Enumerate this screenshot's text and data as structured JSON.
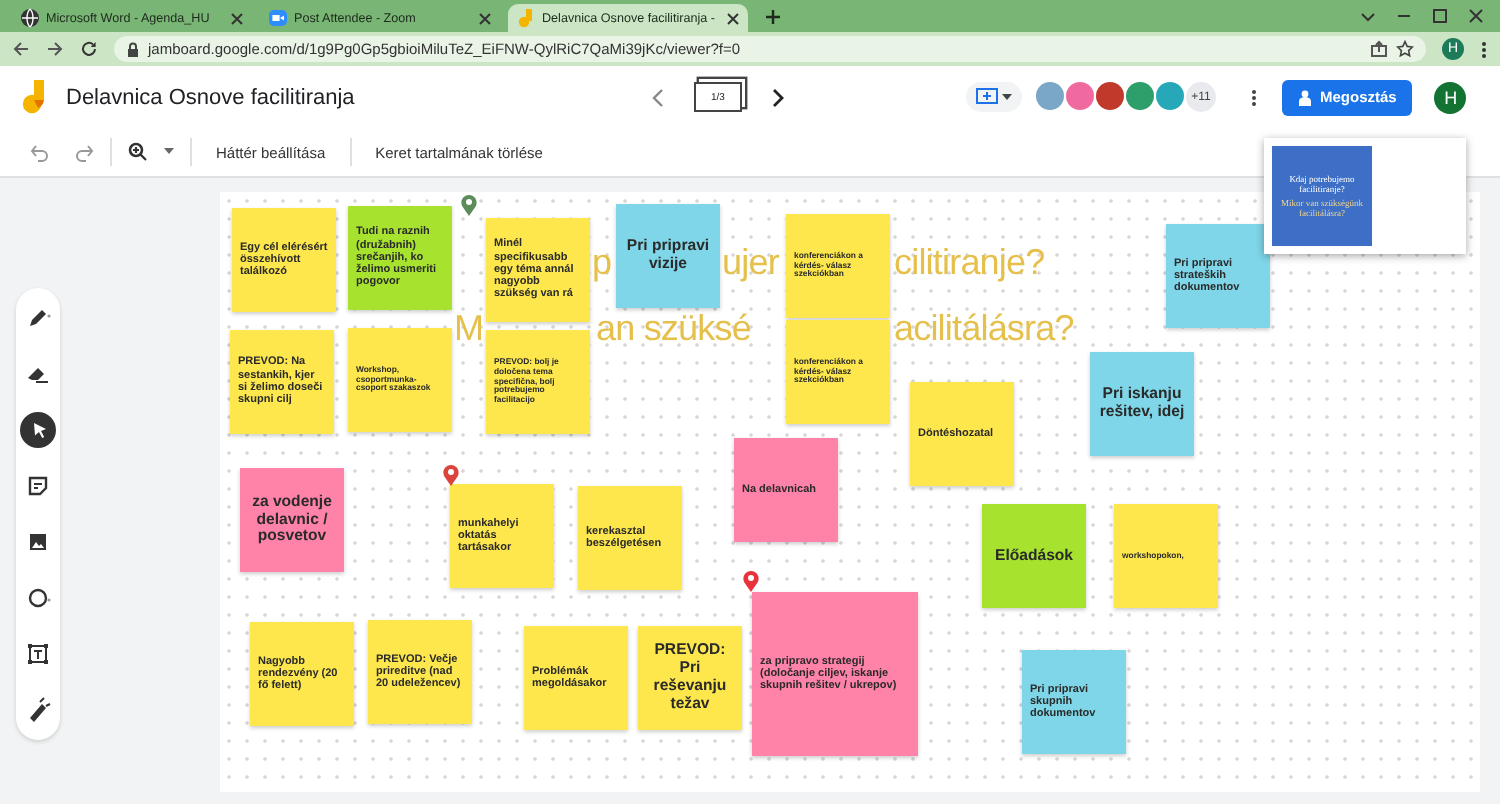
{
  "browser": {
    "tabs": [
      {
        "title": "Microsoft Word - Agenda_HU",
        "kind": "word",
        "selected": false
      },
      {
        "title": "Post Attendee - Zoom",
        "kind": "zoom",
        "selected": false
      },
      {
        "title": "Delavnica Osnove facilitiranja -",
        "kind": "jamboard",
        "selected": true
      }
    ],
    "url": "jamboard.google.com/d/1g9Pg0Gp5gbioiMiluTeZ_EiFNW-QylRiC7QaMi39jKc/viewer?f=0",
    "profile": "H"
  },
  "app": {
    "title": "Delavnica Osnove facilitiranja",
    "frame_counter": "1/3",
    "collaborators": [
      {
        "color": "#7aa7c7"
      },
      {
        "color": "#f06aa0"
      },
      {
        "color": "#c0392b"
      },
      {
        "color": "#2e9e6a"
      },
      {
        "color": "#26a8b8"
      }
    ],
    "collaborators_more": "+11",
    "share_button": "Megosztás",
    "avatar": "H"
  },
  "toolbar": {
    "buttons": [
      "Háttér beállítása",
      "Keret tartalmának törlése"
    ]
  },
  "tools": [
    {
      "kind": "pen",
      "selected": false
    },
    {
      "kind": "eraser",
      "selected": false
    },
    {
      "kind": "select",
      "selected": true
    },
    {
      "kind": "note",
      "selected": false
    },
    {
      "kind": "image",
      "selected": false
    },
    {
      "kind": "circle",
      "selected": false
    },
    {
      "kind": "textbox",
      "selected": false
    },
    {
      "kind": "laser",
      "selected": false
    }
  ],
  "board": {
    "heading_fragments": [
      "p",
      "ujer",
      "cilitiranje?",
      "M",
      "an szüksé",
      "acilitálásra?"
    ],
    "notes": [
      {
        "text": "Egy cél elérésért összehívott találkozó",
        "kind": "normal",
        "color": "#fde74c"
      },
      {
        "text": "Tudi na raznih (družabnih) srečanjih, ko želimo usmeriti pogovor",
        "kind": "normal",
        "color": "#a6e22e"
      },
      {
        "text": "Minél specifikusabb egy téma annál nagyobb szükség van rá",
        "kind": "normal",
        "color": "#fde74c"
      },
      {
        "text": "Pri pripravi vizije",
        "kind": "big",
        "color": "#7fd6e8"
      },
      {
        "text": "konferenciákon a kérdés- válasz szekciókban",
        "kind": "tiny",
        "color": "#fde74c"
      },
      {
        "text": "Pri pripravi strateških dokumentov",
        "kind": "normal",
        "color": "#7fd6e8"
      },
      {
        "text": "PREVOD: Na sestankih, kjer si želimo doseči skupni cilj",
        "kind": "normal",
        "color": "#fde74c"
      },
      {
        "text": "Workshop, csoportmunka-csoport szakaszok",
        "kind": "tiny",
        "color": "#fde74c"
      },
      {
        "text": "PREVOD: bolj je določena tema specifična, bolj potrebujemo facilitacijo",
        "kind": "tiny",
        "color": "#fde74c"
      },
      {
        "text": "konferenciákon a kérdés- válasz szekciókban",
        "kind": "tiny",
        "color": "#fde74c"
      },
      {
        "text": "Döntéshozatal",
        "kind": "normal",
        "color": "#fde74c"
      },
      {
        "text": "Pri iskanju rešitev, idej",
        "kind": "big",
        "color": "#7fd6e8"
      },
      {
        "text": "za vodenje delavnic / posvetov",
        "kind": "big",
        "color": "#ff82a9"
      },
      {
        "text": "munkahelyi oktatás tartásakor",
        "kind": "normal",
        "color": "#fde74c"
      },
      {
        "text": "kerekasztal beszélgetésen",
        "kind": "normal",
        "color": "#fde74c"
      },
      {
        "text": "Na delavnicah",
        "kind": "normal",
        "color": "#ff82a9"
      },
      {
        "text": "Előadások",
        "kind": "big",
        "color": "#a6e22e"
      },
      {
        "text": "workshopokon,",
        "kind": "tiny",
        "color": "#fde74c"
      },
      {
        "text": "Nagyobb rendezvény (20 fő felett)",
        "kind": "normal",
        "color": "#fde74c"
      },
      {
        "text": "PREVOD: Večje prireditve (nad 20 udeležencev)",
        "kind": "normal",
        "color": "#fde74c"
      },
      {
        "text": "Problémák megoldásakor",
        "kind": "normal",
        "color": "#fde74c"
      },
      {
        "text": "PREVOD: Pri reševanju težav",
        "kind": "big",
        "color": "#fde74c"
      },
      {
        "text": "za pripravo strategij (določanje ciljev, iskanje skupnih rešitev / ukrepov)",
        "kind": "normal",
        "color": "#ff82a9"
      },
      {
        "text": "Pri pripravi skupnih dokumentov",
        "kind": "normal",
        "color": "#7fd6e8"
      }
    ],
    "pins": [
      {
        "color": "#5b8c5a"
      },
      {
        "color": "#d9453c"
      },
      {
        "color": "#e8333c"
      }
    ]
  },
  "preview": {
    "title": "Kdaj potrebujemo facilitiranje?",
    "subtitle": "Mikor van szükségünk facilitálásra?"
  }
}
